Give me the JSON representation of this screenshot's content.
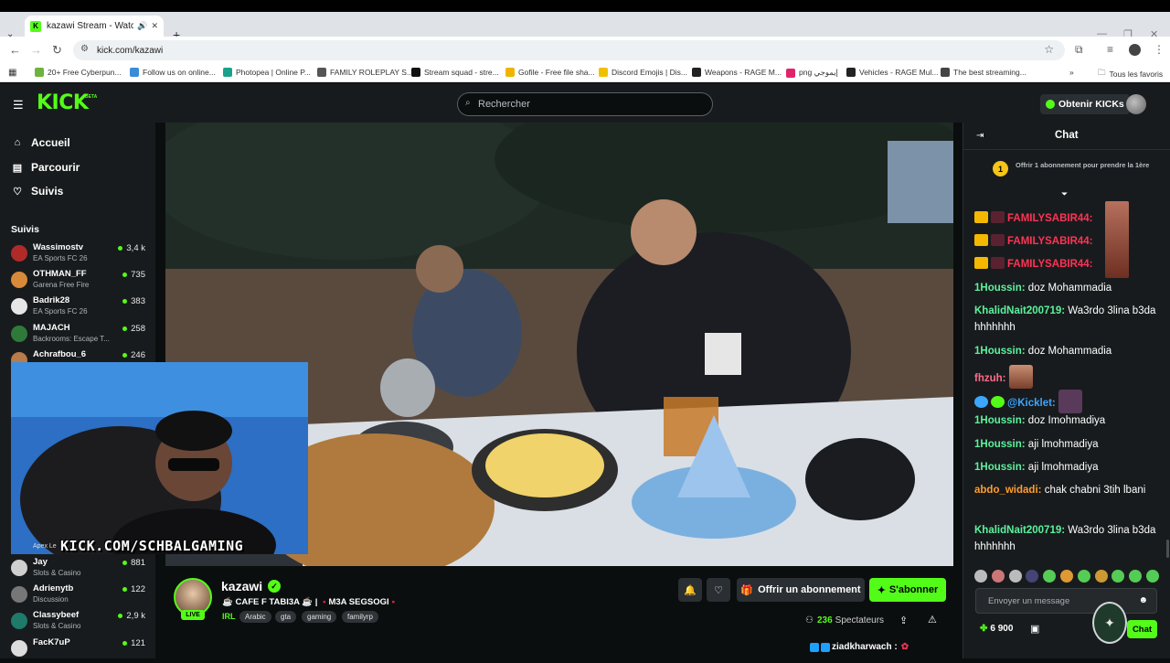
{
  "browser": {
    "tab_title": "kazawi Stream - Watch Live",
    "url": "kick.com/kazawi",
    "bookmarks": [
      {
        "label": "20+ Free Cyberpun...",
        "color": "#6db33f"
      },
      {
        "label": "Follow us on online...",
        "color": "#3a8bd8"
      },
      {
        "label": "Photopea | Online P...",
        "color": "#19a28a"
      },
      {
        "label": "FAMILY ROLEPLAY S...",
        "color": "#555555"
      },
      {
        "label": "Stream squad - stre...",
        "color": "#111111"
      },
      {
        "label": "Gofile - Free file sha...",
        "color": "#f0b400"
      },
      {
        "label": "Discord Emojis | Dis...",
        "color": "#f0c000"
      },
      {
        "label": "Weapons - RAGE M...",
        "color": "#222222"
      },
      {
        "label": "png إيموجي",
        "color": "#e0246a"
      },
      {
        "label": "Vehicles - RAGE Mul...",
        "color": "#222222"
      },
      {
        "label": "The best streaming...",
        "color": "#444444"
      }
    ],
    "bookmarks_folder": "Tous les favoris"
  },
  "header": {
    "logo": "KICK",
    "beta": "BETA",
    "search_placeholder": "Rechercher",
    "get_kicks": "Obtenir KICKs"
  },
  "sidebar": {
    "nav": [
      {
        "label": "Accueil",
        "icon": "home-icon"
      },
      {
        "label": "Parcourir",
        "icon": "browse-icon"
      },
      {
        "label": "Suivis",
        "icon": "heart-icon"
      }
    ],
    "following_heading": "Suivis",
    "channels_top": [
      {
        "name": "Wassimostv",
        "category": "EA Sports FC 26",
        "viewers": "3,4 k",
        "color": "#b02a2a"
      },
      {
        "name": "OTHMAN_FF",
        "category": "Garena Free Fire",
        "viewers": "735",
        "color": "#d88a3a"
      },
      {
        "name": "Badrik28",
        "category": "EA Sports FC 26",
        "viewers": "383",
        "color": "#e6e6e6"
      },
      {
        "name": "MAJACH",
        "category": "Backrooms: Escape T...",
        "viewers": "258",
        "color": "#2f7a3a"
      },
      {
        "name": "Achrafbou_6",
        "category": "",
        "viewers": "246",
        "color": "#b87b4a"
      }
    ],
    "channels_bottom": [
      {
        "name": "Jay",
        "category": "Slots & Casino",
        "viewers": "881",
        "color": "#cfcfcf"
      },
      {
        "name": "Adrienytb",
        "category": "Discussion",
        "viewers": "122",
        "color": "#777777"
      },
      {
        "name": "Classybeef",
        "category": "Slots & Casino",
        "viewers": "2,9 k",
        "color": "#1f7a6a"
      },
      {
        "name": "FacK7uP",
        "category": "",
        "viewers": "121",
        "color": "#dddddd"
      }
    ],
    "partial_category": "Apex Le"
  },
  "stream": {
    "cam_overlay_text": "KICK.COM/SCHBALGAMING",
    "streamer": "kazawi",
    "live": "LIVE",
    "title_part1": "☕ CAFE F TABI3A ☕ |",
    "title_part2": "M3A SEGSOGI",
    "category": "IRL",
    "tags": [
      "Arabic",
      "gta",
      "gaming",
      "familyrp"
    ],
    "gift_sub": "Offrir un abonnement",
    "subscribe": "S'abonner",
    "viewer_count": "236",
    "viewer_label": "Spectateurs",
    "floating_user": "ziadkharwach :"
  },
  "chat": {
    "title": "Chat",
    "pinned_count": "1",
    "pinned_text": "Offrir 1 abonnement pour prendre la 1ère",
    "messages": [
      {
        "user": "FAMILYSABIR44:",
        "text": "",
        "color": "#ff3355"
      },
      {
        "user": "FAMILYSABIR44:",
        "text": "",
        "color": "#ff3355"
      },
      {
        "user": "FAMILYSABIR44:",
        "text": "",
        "color": "#ff3355"
      },
      {
        "user": "1Houssin:",
        "text": "doz Mohammadia",
        "color": "#5cf29d"
      },
      {
        "user": "KhalidNait200719:",
        "text": "Wa3rdo 3lina b3da hhhhhhh",
        "color": "#5cf29d"
      },
      {
        "user": "1Houssin:",
        "text": "doz Mohammadia",
        "color": "#5cf29d"
      },
      {
        "user": "fhzuh:",
        "text": "",
        "color": "#ff6b8a"
      },
      {
        "user": "@Kicklet:",
        "text": "",
        "color": "#3da6ff"
      },
      {
        "user": "1Houssin:",
        "text": "doz Imohmadiya",
        "color": "#5cf29d"
      },
      {
        "user": "1Houssin:",
        "text": "aji lmohmadiya",
        "color": "#5cf29d"
      },
      {
        "user": "1Houssin:",
        "text": "aji lmohmadiya",
        "color": "#5cf29d"
      },
      {
        "user": "abdo_widadi:",
        "text": "chak chabni 3tih lbani",
        "color": "#ff9d2e"
      },
      {
        "user": "KhalidNait200719:",
        "text": "Wa3rdo 3lina b3da hhhhhhh",
        "color": "#5cf29d"
      }
    ],
    "input_placeholder": "Envoyer un message",
    "kicks_balance": "6 900",
    "send_label": "Chat"
  },
  "colors": {
    "accent": "#53fc18",
    "bg": "#0b0e0f",
    "panel": "#181b1d"
  }
}
